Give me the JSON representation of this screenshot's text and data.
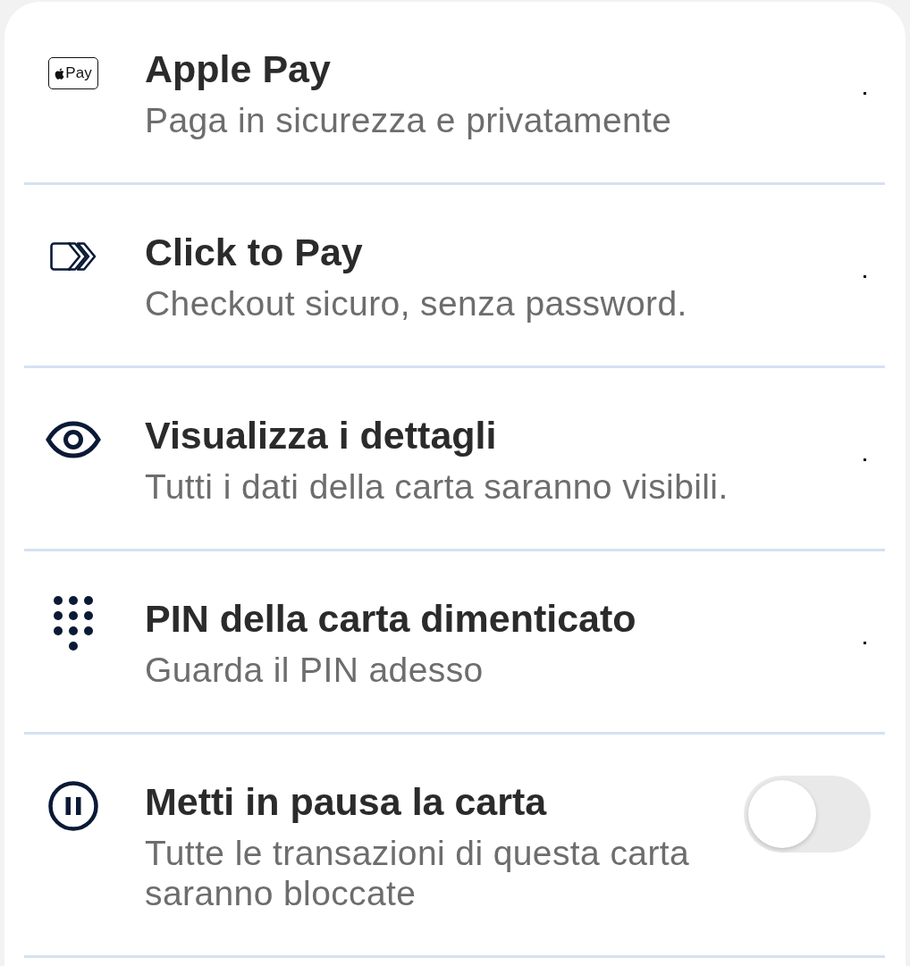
{
  "rows": [
    {
      "kind": "link",
      "title": "Apple Pay",
      "description": "Paga in sicurezza e privatamente",
      "logo_text": "Pay"
    },
    {
      "kind": "link",
      "title": "Click to Pay",
      "description": "Checkout sicuro, senza password."
    },
    {
      "kind": "link",
      "title": "Visualizza i dettagli",
      "description": "Tutti i dati della carta saranno visibili."
    },
    {
      "kind": "link",
      "title": "PIN della carta dimenticato",
      "description": "Guarda il PIN adesso"
    },
    {
      "kind": "toggle",
      "title": "Metti in pausa la carta",
      "description": "Tutte le transazioni di questa carta saranno bloccate",
      "on": false
    }
  ]
}
